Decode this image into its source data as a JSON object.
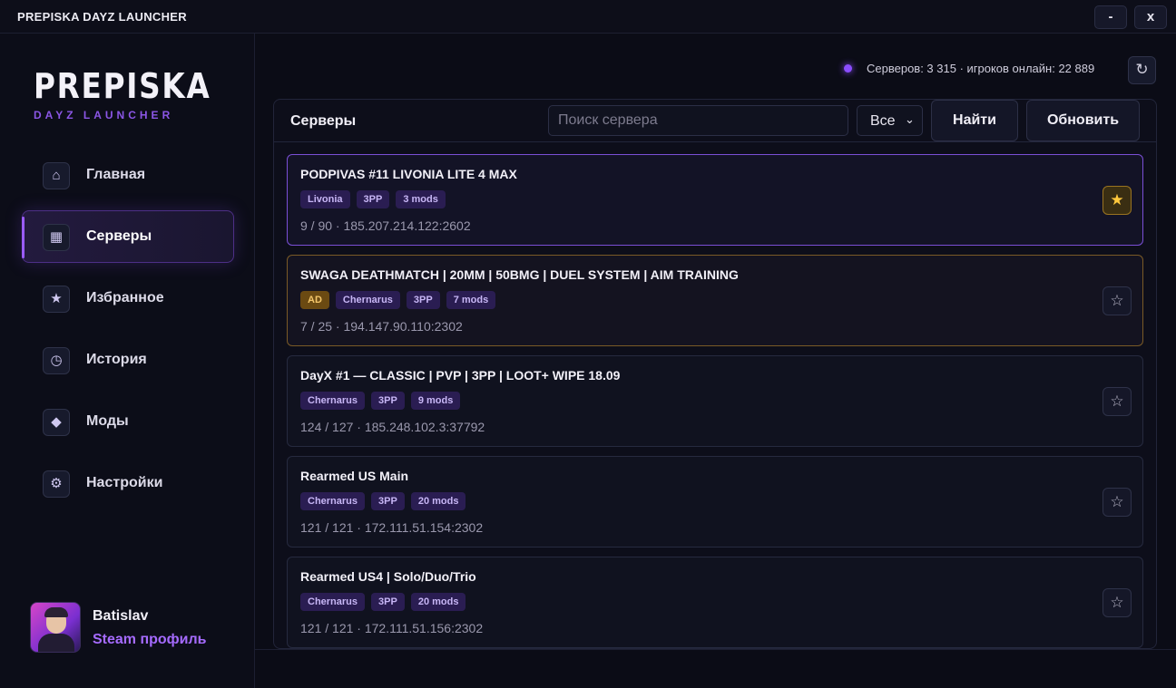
{
  "window": {
    "title": "PREPISKA DAYZ LAUNCHER",
    "minimize_label": "-",
    "close_label": "x"
  },
  "brand": {
    "logo": "PREPISKA",
    "subtitle": "DAYZ LAUNCHER"
  },
  "sidebar": {
    "items": [
      {
        "label": "Главная",
        "icon": "home-icon",
        "glyph": "⌂"
      },
      {
        "label": "Серверы",
        "icon": "servers-grid-icon",
        "glyph": "▦",
        "active": true
      },
      {
        "label": "Избранное",
        "icon": "star-icon",
        "glyph": "★"
      },
      {
        "label": "История",
        "icon": "history-clock-icon",
        "glyph": "◷"
      },
      {
        "label": "Моды",
        "icon": "diamond-icon",
        "glyph": "◆"
      },
      {
        "label": "Настройки",
        "icon": "gear-icon",
        "glyph": "⚙"
      }
    ]
  },
  "profile": {
    "name": "Batislav",
    "link": "Steam профиль"
  },
  "stats": {
    "text": "Серверов: 3 315 · игроков онлайн: 22 889",
    "refresh_glyph": "↻"
  },
  "panel": {
    "title": "Серверы",
    "search_placeholder": "Поиск сервера",
    "filter_value": "Все",
    "filter_chevron": "⌄",
    "find_label": "Найти",
    "update_label": "Обновить"
  },
  "servers": [
    {
      "name": "PODPIVAS #11 LIVONIA LITE 4 MAX",
      "tags": [
        "Livonia",
        "3PP",
        "3 mods"
      ],
      "meta": "9 / 90 · 185.207.214.122:2602",
      "favorite": true,
      "ad": false,
      "selected": true
    },
    {
      "name": "SWAGA DEATHMATCH | 20MM | 50BMG | DUEL SYSTEM | AIM TRAINING",
      "tags": [
        "Chernarus",
        "3PP",
        "7 mods"
      ],
      "ad_label": "AD",
      "meta": "7 / 25 · 194.147.90.110:2302",
      "favorite": false,
      "ad": true,
      "selected": false
    },
    {
      "name": "DayX #1 — CLASSIC | PVP | 3PP | LOOT+ WIPE 18.09",
      "tags": [
        "Chernarus",
        "3PP",
        "9 mods"
      ],
      "meta": "124 / 127 · 185.248.102.3:37792",
      "favorite": false,
      "ad": false,
      "selected": false
    },
    {
      "name": "Rearmed US Main",
      "tags": [
        "Chernarus",
        "3PP",
        "20 mods"
      ],
      "meta": "121 / 121 · 172.111.51.154:2302",
      "favorite": false,
      "ad": false,
      "selected": false
    },
    {
      "name": "Rearmed US4 | Solo/Duo/Trio",
      "tags": [
        "Chernarus",
        "3PP",
        "20 mods"
      ],
      "meta": "121 / 121 · 172.111.51.156:2302",
      "favorite": false,
      "ad": false,
      "selected": false
    }
  ],
  "colors": {
    "accent": "#9a5bff",
    "favorite": "#ffc83d",
    "ad": "#f4c66a",
    "background": "#0b0c16"
  },
  "glyphs": {
    "star_filled": "★",
    "star_empty": "☆"
  }
}
